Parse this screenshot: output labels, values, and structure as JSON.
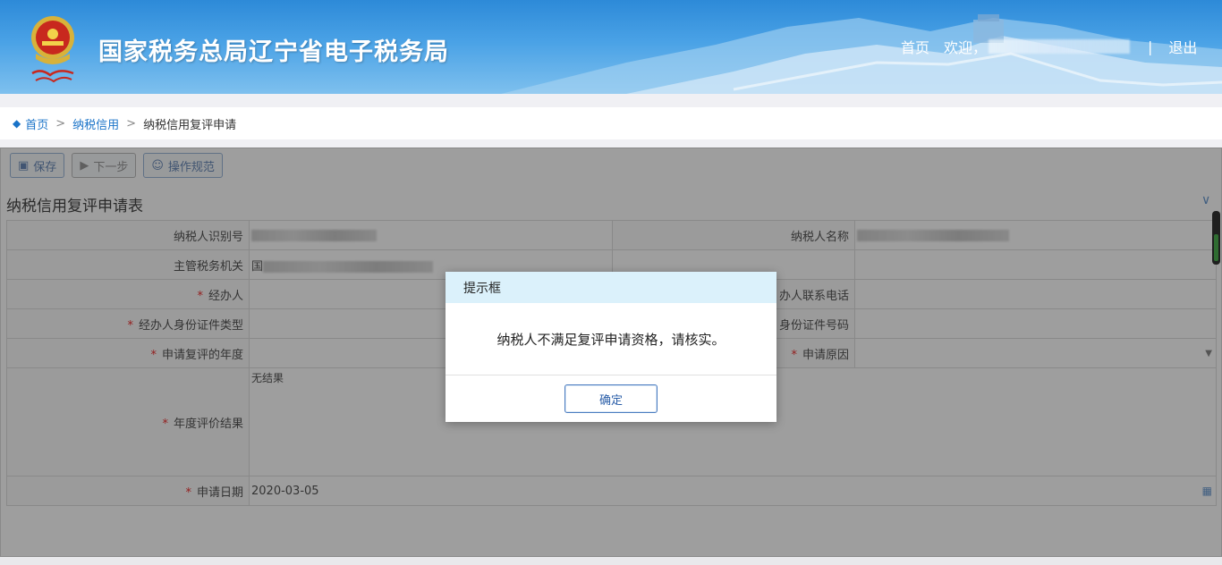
{
  "header": {
    "site_title": "国家税务总局辽宁省电子税务局",
    "nav_home": "首页",
    "welcome": "欢迎，",
    "separator": "|",
    "logout": "退出"
  },
  "breadcrumb": {
    "items": [
      "首页",
      "纳税信用",
      "纳税信用复评申请"
    ]
  },
  "toolbar": {
    "save": "保存",
    "next": "下一步",
    "guide": "操作规范"
  },
  "form": {
    "title": "纳税信用复评申请表",
    "taxpayer_id_label": "纳税人识别号",
    "taxpayer_name_label": "纳税人名称",
    "tax_authority_label": "主管税务机关",
    "tax_authority_prefix": "国",
    "handler_label": "经办人",
    "handler_phone_label": "办人联系电话",
    "handler_id_type_label": "经办人身份证件类型",
    "handler_id_no_label": "身份证件号码",
    "review_year_label": "申请复评的年度",
    "reason_label": "申请原因",
    "annual_result_label": "年度评价结果",
    "annual_result_value": "无结果",
    "apply_date_label": "申请日期",
    "apply_date_value": "2020-03-05",
    "required_mark": "*"
  },
  "modal": {
    "title": "提示框",
    "message": "纳税人不满足复评申请资格，请核实。",
    "ok": "确定"
  },
  "colors": {
    "header_blue": "#2d8ad8",
    "link_blue": "#1a73c8",
    "modal_header": "#dbf1fb",
    "required_red": "#e33"
  }
}
